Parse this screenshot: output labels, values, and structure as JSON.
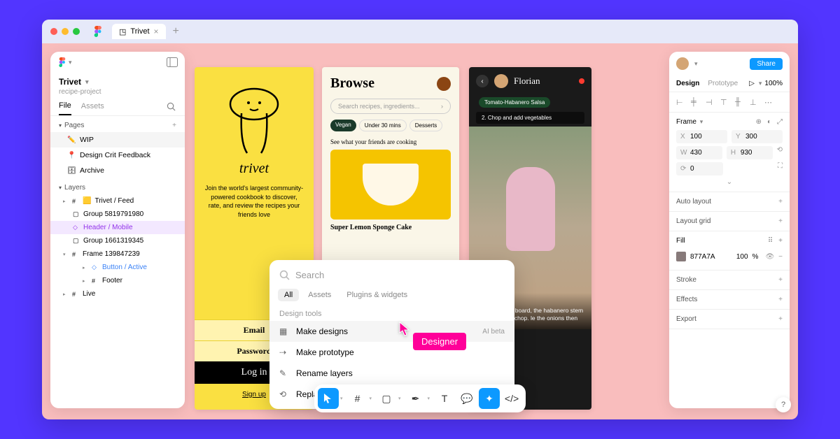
{
  "titlebar": {
    "tab_name": "Trivet"
  },
  "left_panel": {
    "title": "Trivet",
    "subtitle": "recipe-project",
    "tabs": {
      "file": "File",
      "assets": "Assets"
    },
    "pages_label": "Pages",
    "pages": [
      {
        "icon": "✏️",
        "label": "WIP"
      },
      {
        "icon": "📍",
        "label": "Design Crit Feedback"
      },
      {
        "icon": "🗄",
        "label": "Archive"
      }
    ],
    "layers_label": "Layers",
    "layers": [
      {
        "label": "Trivet / Feed",
        "icon": "#",
        "caret": true,
        "flag": true
      },
      {
        "label": "Group 5819791980",
        "icon": "▢",
        "indent": 1
      },
      {
        "label": "Header / Mobile",
        "icon": "◇",
        "indent": 1,
        "sel": true
      },
      {
        "label": "Group 1661319345",
        "icon": "▢",
        "indent": 1
      },
      {
        "label": "Frame 139847239",
        "icon": "#",
        "caret": true
      },
      {
        "label": "Button / Active",
        "icon": "◇",
        "indent": 2,
        "blue": true
      },
      {
        "label": "Footer",
        "icon": "#",
        "indent": 2
      },
      {
        "label": "Live",
        "icon": "#",
        "caret": true
      }
    ]
  },
  "frame1": {
    "brand": "trivet",
    "tagline": "Join the world's largest community-powered cookbook to discover, rate, and review the recipes your friends love",
    "email": "Email",
    "password": "Password",
    "login": "Log in",
    "signup": "Sign up"
  },
  "frame2": {
    "title": "Browse",
    "search_placeholder": "Search recipes, ingredients...",
    "chips": [
      "Vegan",
      "Under 30 mins",
      "Desserts"
    ],
    "subtitle": "See what your friends are cooking",
    "recipe": "Super Lemon Sponge Cake"
  },
  "frame3": {
    "name": "Florian",
    "pill": "Tomato-Habanero Salsa",
    "step": "2. Chop and add vegetables",
    "caption": "...large cutting board, the habanero stem eds and finely chop. le the onions then"
  },
  "right_panel": {
    "share": "Share",
    "tabs": {
      "design": "Design",
      "prototype": "Prototype"
    },
    "zoom": "100%",
    "frame_label": "Frame",
    "x": "100",
    "y": "300",
    "w": "430",
    "h": "930",
    "rot": "0",
    "auto_layout": "Auto layout",
    "layout_grid": "Layout grid",
    "fill": "Fill",
    "fill_hex": "877A7A",
    "fill_opacity": "100",
    "fill_pct": "%",
    "stroke": "Stroke",
    "effects": "Effects",
    "export": "Export"
  },
  "popup": {
    "search_placeholder": "Search",
    "tabs": [
      "All",
      "Assets",
      "Plugins & widgets"
    ],
    "section": "Design tools",
    "items": [
      {
        "label": "Make designs",
        "badge": "AI beta"
      },
      {
        "label": "Make prototype"
      },
      {
        "label": "Rename layers"
      },
      {
        "label": "Replace content"
      }
    ]
  },
  "cursor_tag": "Designer"
}
